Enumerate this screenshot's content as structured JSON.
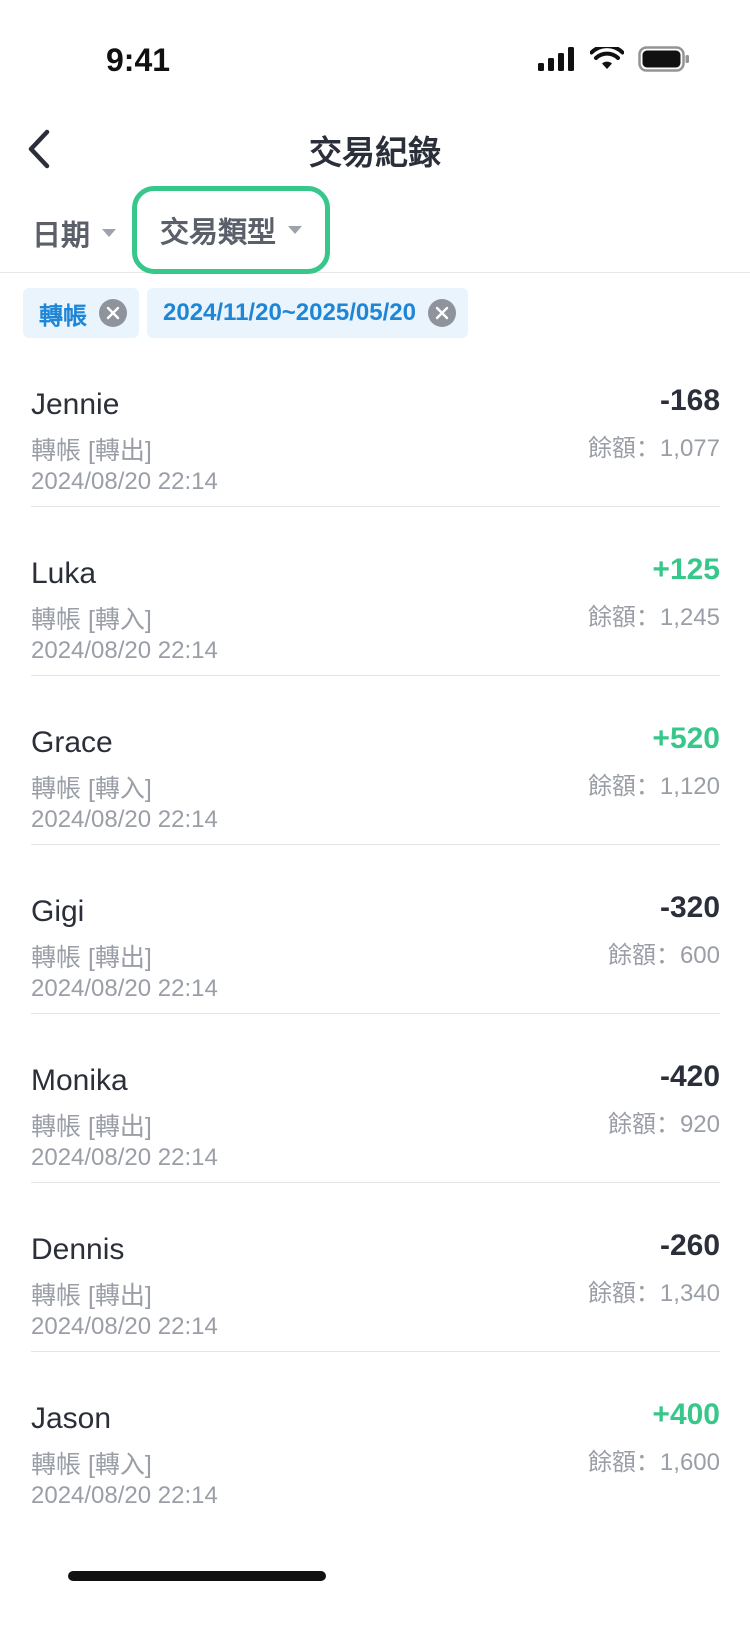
{
  "status_bar": {
    "time": "9:41"
  },
  "nav": {
    "title": "交易紀錄"
  },
  "filters": {
    "date_label": "日期",
    "type_label": "交易類型"
  },
  "chips": [
    {
      "label": "轉帳"
    },
    {
      "label": "2024/11/20~2025/05/20"
    }
  ],
  "transactions": [
    {
      "name": "Jennie",
      "type": "轉帳 [轉出]",
      "time": "2024/08/20 22:14",
      "amount": "-168",
      "balance": "餘額：1,077",
      "direction": "out"
    },
    {
      "name": "Luka",
      "type": "轉帳 [轉入]",
      "time": "2024/08/20 22:14",
      "amount": "+125",
      "balance": "餘額：1,245",
      "direction": "in"
    },
    {
      "name": "Grace",
      "type": "轉帳 [轉入]",
      "time": "2024/08/20 22:14",
      "amount": "+520",
      "balance": "餘額：1,120",
      "direction": "in"
    },
    {
      "name": "Gigi",
      "type": "轉帳 [轉出]",
      "time": "2024/08/20 22:14",
      "amount": "-320",
      "balance": "餘額：600",
      "direction": "out"
    },
    {
      "name": "Monika",
      "type": "轉帳 [轉出]",
      "time": "2024/08/20 22:14",
      "amount": "-420",
      "balance": "餘額：920",
      "direction": "out"
    },
    {
      "name": "Dennis",
      "type": "轉帳 [轉出]",
      "time": "2024/08/20 22:14",
      "amount": "-260",
      "balance": "餘額：1,340",
      "direction": "out"
    },
    {
      "name": "Jason",
      "type": "轉帳 [轉入]",
      "time": "2024/08/20 22:14",
      "amount": "+400",
      "balance": "餘額：1,600",
      "direction": "in"
    }
  ],
  "colors": {
    "accent_green": "#38c78a",
    "chip_blue": "#1f86d6",
    "chip_bg": "#eaf4fc"
  }
}
